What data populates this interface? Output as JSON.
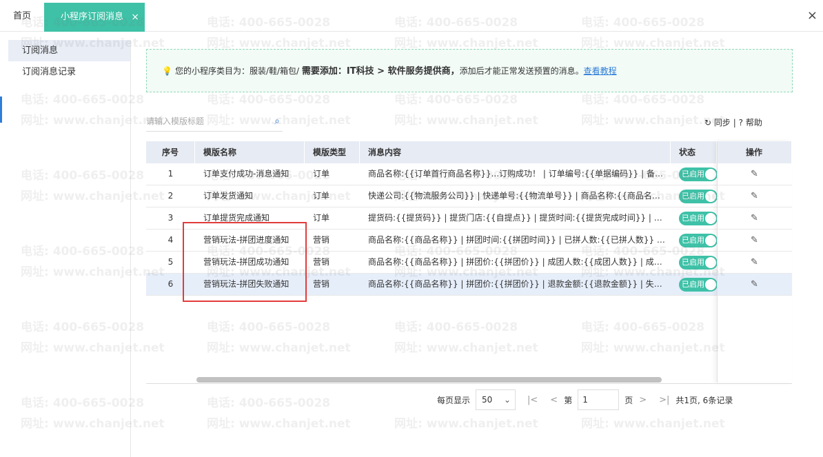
{
  "tabs": {
    "home": "首页",
    "active": "小程序订阅消息",
    "active_close": "×",
    "window_close": "×"
  },
  "sidebar": {
    "items": [
      {
        "label": "订阅消息",
        "active": true
      },
      {
        "label": "订阅消息记录",
        "active": false
      }
    ]
  },
  "notice": {
    "icon": "lightbulb-icon",
    "text1": "您的小程序类目为：服装/鞋/箱包/",
    "bold": "需要添加：IT科技 > 软件服务提供商，",
    "text2": "添加后才能正常发送预置的消息。",
    "link": "查看教程"
  },
  "search": {
    "placeholder": "请输入模版标题",
    "icon": "search-icon"
  },
  "toolbar": {
    "sync": "同步",
    "help": "帮助",
    "sep": "|"
  },
  "table": {
    "headers": [
      "序号",
      "模版名称",
      "模版类型",
      "消息内容",
      "状态",
      "操作"
    ],
    "rows": [
      {
        "no": "1",
        "name": "订单支付成功-消息通知",
        "type": "订单",
        "content": "商品名称:{{订单首行商品名称}}...订购成功！ | 订单编号:{{单据编码}} | 备注:我们...",
        "status": "已启用"
      },
      {
        "no": "2",
        "name": "订单发货通知",
        "type": "订单",
        "content": "快递公司:{{物流服务公司}} | 快递单号:{{物流单号}} | 商品名称:{{商品名称}}... | ...",
        "status": "已启用"
      },
      {
        "no": "3",
        "name": "订单提货完成通知",
        "type": "订单",
        "content": "提货码:{{提货码}} | 提货门店:{{自提点}} | 提货时间:{{提货完成时间}} | 备注:{{订...",
        "status": "已启用"
      },
      {
        "no": "4",
        "name": "营销玩法-拼团进度通知",
        "type": "营销",
        "content": "商品名称:{{商品名称}} | 拼团时间:{{拼团时间}} | 已拼人数:{{已拼人数}} | 剩余时...",
        "status": "已启用"
      },
      {
        "no": "5",
        "name": "营销玩法-拼团成功通知",
        "type": "营销",
        "content": "商品名称:{{商品名称}} | 拼团价:{{拼团价}} | 成团人数:{{成团人数}} | 成团时间:{{...",
        "status": "已启用"
      },
      {
        "no": "6",
        "name": "营销玩法-拼团失败通知",
        "type": "营销",
        "content": "商品名称:{{商品名称}} | 拼团价:{{拼团价}} | 退款金额:{{退款金额}} | 失败原因:超...",
        "status": "已启用"
      }
    ]
  },
  "pager": {
    "per_page_label": "每页显示",
    "per_page": "50",
    "page_prefix": "第",
    "page": "1",
    "page_suffix": "页",
    "summary": "共1页, 6条记录"
  },
  "watermark": {
    "phone": "电话: 400-665-0028",
    "site": "网址: www.chanjet.net"
  },
  "colors": {
    "accent": "#3ec1a7",
    "link": "#2f7dd8",
    "highlight_box": "#e23b3b"
  }
}
